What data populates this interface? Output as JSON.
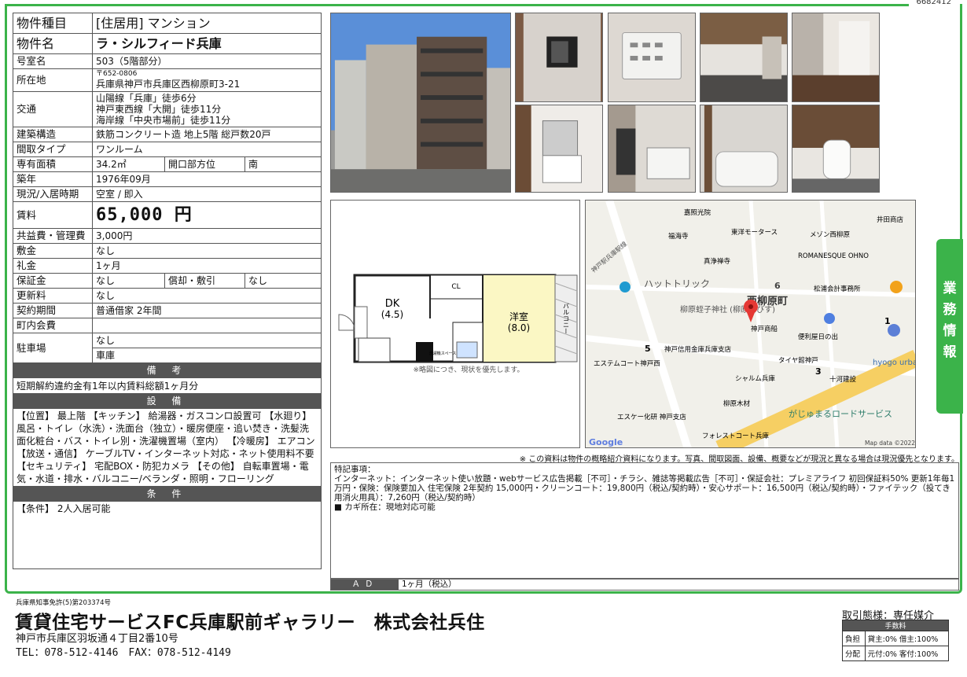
{
  "doc_number": "6682412",
  "property": {
    "type_label": "物件種目",
    "type_value": "[住居用] マンション",
    "name_label": "物件名",
    "name_value": "ラ・シルフィード兵庫",
    "room_label": "号室名",
    "room_value": "503（5階部分）",
    "location_label": "所在地",
    "postal": "〒652-0806",
    "address": "兵庫県神戸市兵庫区西柳原町3-21",
    "transport_label": "交通",
    "transport": [
      "山陽線「兵庫」徒歩6分",
      "神戸東西線「大開」徒歩11分",
      "海岸線「中央市場前」徒歩11分"
    ],
    "structure_label": "建築構造",
    "structure_value": "鉄筋コンクリート造 地上5階 総戸数20戸",
    "layout_label": "間取タイプ",
    "layout_value": "ワンルーム",
    "area_label": "専有面積",
    "area_value": "34.2㎡",
    "facing_label": "開口部方位",
    "facing_value": "南",
    "built_label": "築年",
    "built_value": "1976年09月",
    "status_label": "現況/入居時期",
    "status_value": "空室 / 即入",
    "rent_label": "賃料",
    "rent_value": "65,000 円",
    "fee_label": "共益費・管理費",
    "fee_value": "3,000円",
    "deposit_label": "敷金",
    "deposit_value": "なし",
    "keymoney_label": "礼金",
    "keymoney_value": "1ヶ月",
    "guarantee_label": "保証金",
    "guarantee_value": "なし",
    "amort_label": "償却・敷引",
    "amort_value": "なし",
    "renewal_label": "更新料",
    "renewal_value": "なし",
    "contract_label": "契約期間",
    "contract_value": "普通借家 2年間",
    "town_label": "町内会費",
    "town_value": "",
    "parking_label": "駐車場",
    "parking_value1": "なし",
    "parking_value2": "車庫"
  },
  "remarks_section": {
    "title": "備 考",
    "text": "短期解約違約金有1年以内賃料総額1ヶ月分"
  },
  "facilities_section": {
    "title": "設 備",
    "text": "【位置】 最上階 【キッチン】 給湯器・ガスコンロ設置可 【水廻り】 風呂・トイレ（水洗）・洗面台（独立）・暖房便座・追い焚き・洗髪洗面化粧台・バス・トイレ別・洗濯機置場（室内） 【冷暖房】 エアコン 【放送・通信】 ケーブルTV・インターネット対応・ネット使用料不要 【セキュリティ】 宅配BOX・防犯カメラ 【その他】 自転車置場・電気・水道・排水・バルコニー/ベランダ・照明・フローリング"
  },
  "conditions_section": {
    "title": "条 件",
    "text": "【条件】 2人入居可能"
  },
  "floorplan": {
    "dk_label": "DK",
    "dk_size": "(4.5)",
    "room_label": "洋室",
    "room_size": "(8.0)",
    "closet_label": "CL",
    "balcony_label": "バルコニー",
    "washer_label": "洗濯機スペース",
    "note": "※略図につき、現状を優先します。"
  },
  "map": {
    "labels": [
      "嘉照光院",
      "井田商店",
      "福海寺",
      "東洋モータース",
      "メゾン西柳原",
      "真浄禅寺",
      "ROMANESQUE OHNO",
      "ハットトリック",
      "6",
      "松浦会計事務所",
      "柳原蛭子神社\n(柳原えびす)",
      "西柳原町",
      "神戸商船",
      "便利屋日の出",
      "1",
      "5",
      "神戸信用金庫兵庫支店",
      "エステムコート神戸西",
      "タイヤ館神戸",
      "3",
      "hyogo urba",
      "十河建設",
      "シャルム兵庫",
      "柳原木材",
      "エスケー化研 神戸支店",
      "がじゅまるロードサービス",
      "フォレストコート兵庫",
      "神戸駅兵庫駅線"
    ],
    "google": "Google",
    "credit": "Map data ©2022"
  },
  "notice": "※ この資料は物件の概略紹介資料になります。写真、間取図面、設備、概要などが現況と異なる場合は現況優先となります。",
  "special": {
    "title": "特記事項：",
    "body": "インターネット：インターネット使い放題・webサービス広告掲載［不可］・チラシ、雑誌等掲載広告［不可］・保証会社：プレミアライフ 初回保証料50% 更新1年毎1万円・保険：保険要加入 住宅保険 2年契約 15,000円・クリーンコート：19,800円（税込/契約時）・安心サポート：16,500円（税込/契約時）・ファイテック（投てき用消火用具）：7,260円（税込/契約時）",
    "key": "■ カギ所在：現地対応可能"
  },
  "ad": {
    "label": "ＡＤ",
    "value": "1ヶ月（税込）"
  },
  "side_tab": [
    "業",
    "務",
    "情",
    "報"
  ],
  "footer": {
    "license": "兵庫県知事免許(5)第203374号",
    "company": "賃貸住宅サービスFC兵庫駅前ギャラリー　株式会社兵住",
    "address": "神戸市兵庫区羽坂通４丁目2番10号",
    "tel": "TEL：078-512-4146　FAX：078-512-4149",
    "deal_type": "取引態様：専任媒介",
    "fee_header": "手数料",
    "burden_label": "負担",
    "burden_value": "貸主:0% 借主:100%",
    "split_label": "分配",
    "split_value": "元付:0% 客付:100%"
  },
  "colors": {
    "accent": "#3bb34a",
    "header_gray": "#555555"
  }
}
